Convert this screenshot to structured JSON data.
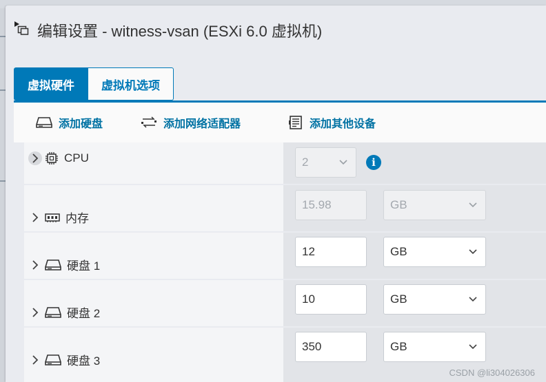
{
  "dialog": {
    "title": "编辑设置 - witness-vsan (ESXi 6.0 虚拟机)",
    "title_icon": "vm-settings-icon"
  },
  "tabs": [
    {
      "label": "虚拟硬件",
      "active": true
    },
    {
      "label": "虚拟机选项",
      "active": false
    }
  ],
  "toolbar": {
    "add_disk": "添加硬盘",
    "add_network": "添加网络适配器",
    "add_other": "添加其他设备"
  },
  "rows": [
    {
      "label": "CPU",
      "icon": "cpu-icon",
      "value": "2",
      "disabled": true,
      "has_info": true
    },
    {
      "label": "内存",
      "icon": "memory-icon",
      "value": "15.98",
      "unit": "GB",
      "disabled": true
    },
    {
      "label": "硬盘 1",
      "icon": "disk-icon",
      "value": "12",
      "unit": "GB",
      "disabled": false
    },
    {
      "label": "硬盘 2",
      "icon": "disk-icon",
      "value": "10",
      "unit": "GB",
      "disabled": false
    },
    {
      "label": "硬盘 3",
      "icon": "disk-icon",
      "value": "350",
      "unit": "GB",
      "disabled": false
    }
  ],
  "colors": {
    "accent": "#0079b8",
    "link": "#0072a3"
  },
  "watermark": "CSDN @li304026306"
}
